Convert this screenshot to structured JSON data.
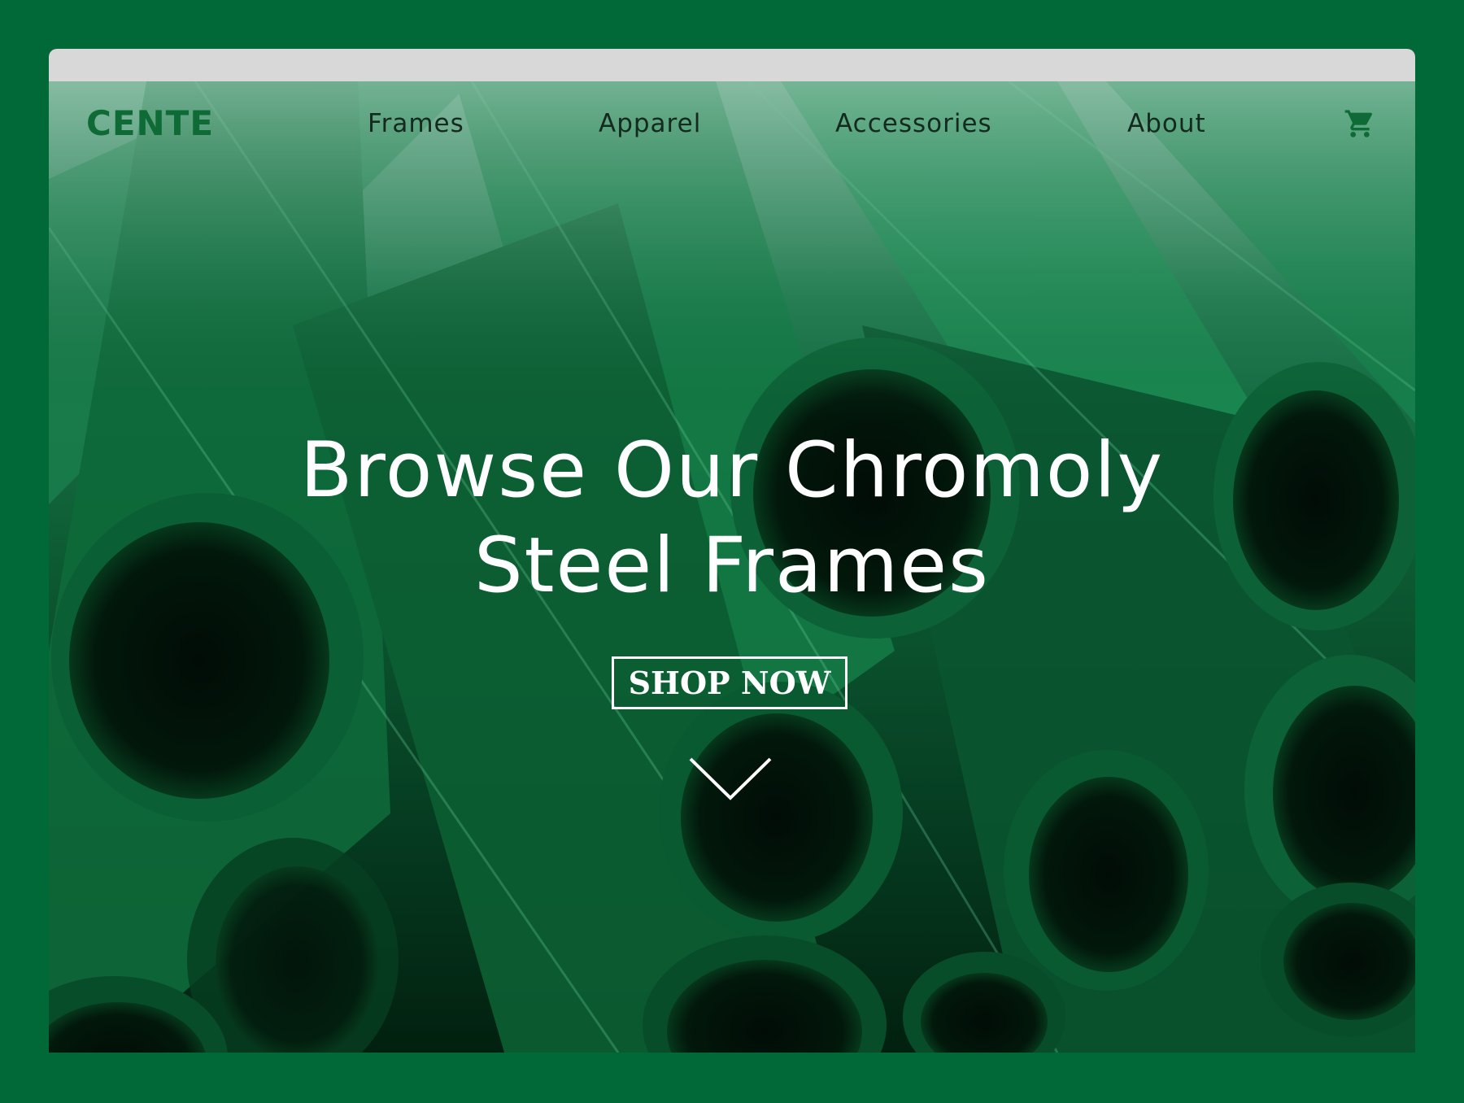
{
  "logo": {
    "text": "CENTE"
  },
  "nav": {
    "items": [
      {
        "label": "Frames"
      },
      {
        "label": "Apparel"
      },
      {
        "label": "Accessories"
      },
      {
        "label": "About"
      }
    ],
    "cart_icon": "cart-icon"
  },
  "hero": {
    "headline_line1": "Browse Our Chromoly",
    "headline_line2": "Steel Frames",
    "cta_label": "SHOP NOW",
    "scroll_icon": "chevron-down-icon"
  },
  "colors": {
    "page_background": "#016837",
    "browser_bar": "#d8d8d8",
    "brand_green": "#0f6b36",
    "hero_text": "#ffffff",
    "nav_text": "#142a1e"
  }
}
